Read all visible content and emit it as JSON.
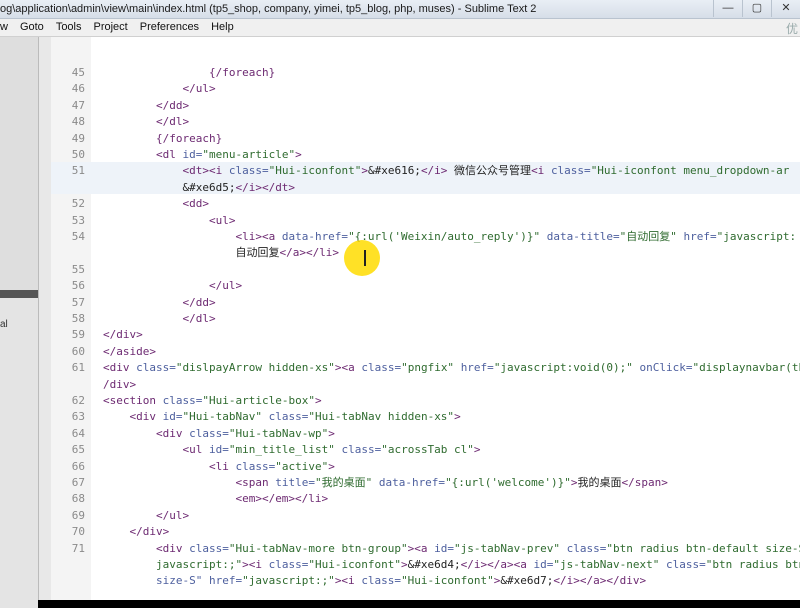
{
  "window": {
    "title": "og\\application\\admin\\view\\main\\index.html (tp5_shop, company, yimei, tp5_blog, php, muses) - Sublime Text 2",
    "buttons": [
      "—",
      "▢",
      "✕"
    ]
  },
  "menu": [
    "w",
    "Goto",
    "Tools",
    "Project",
    "Preferences",
    "Help"
  ],
  "watermark": "优",
  "sidebar_fragment": "al",
  "lines": [
    {
      "n": "45",
      "html": "                <span class=\"tag\">{/foreach}</span>"
    },
    {
      "n": "46",
      "html": "            <span class=\"tag\">&lt;/ul&gt;</span>"
    },
    {
      "n": "47",
      "html": "        <span class=\"tag\">&lt;/dd&gt;</span>"
    },
    {
      "n": "48",
      "html": "        <span class=\"tag\">&lt;/dl&gt;</span>"
    },
    {
      "n": "49",
      "html": "        <span class=\"tag\">{/foreach}</span>"
    },
    {
      "n": "50",
      "html": "        <span class=\"tag\">&lt;dl</span> <span class=\"attr\">id=</span><span class=\"str\">\"menu-article\"</span><span class=\"tag\">&gt;</span>"
    },
    {
      "n": "51",
      "html": "            <span class=\"tag\">&lt;dt&gt;&lt;i</span> <span class=\"attr\">class=</span><span class=\"str\">\"Hui-iconfont\"</span><span class=\"tag\">&gt;</span>&amp;#xe616;<span class=\"tag\">&lt;/i&gt;</span> 微信公众号管理<span class=\"tag\">&lt;i</span> <span class=\"attr\">class=</span><span class=\"str\">\"Hui-iconfont menu_dropdown-ar</span>"
    },
    {
      "n": "",
      "html": "            &amp;#xe6d5;<span class=\"tag\">&lt;/i&gt;&lt;/dt&gt;</span>"
    },
    {
      "n": "52",
      "html": "            <span class=\"tag\">&lt;dd&gt;</span>"
    },
    {
      "n": "53",
      "html": "                <span class=\"tag\">&lt;ul&gt;</span>"
    },
    {
      "n": "54",
      "html": "                    <span class=\"tag\">&lt;li&gt;&lt;a</span> <span class=\"attr\">data-href=</span><span class=\"str\">\"{:url('Weixin/auto_reply')}\"</span> <span class=\"attr\">data-title=</span><span class=\"str\">\"自动回复\"</span> <span class=\"attr\">href=</span><span class=\"str\">\"javascript:</span>"
    },
    {
      "n": "",
      "html": "                    自动回复<span class=\"tag\">&lt;/a&gt;&lt;/li&gt;</span>"
    },
    {
      "n": "55",
      "html": ""
    },
    {
      "n": "56",
      "html": "                <span class=\"tag\">&lt;/ul&gt;</span>"
    },
    {
      "n": "57",
      "html": "            <span class=\"tag\">&lt;/dd&gt;</span>"
    },
    {
      "n": "58",
      "html": "            <span class=\"tag\">&lt;/dl&gt;</span>"
    },
    {
      "n": "59",
      "html": "<span class=\"tag\">&lt;/div&gt;</span>"
    },
    {
      "n": "60",
      "html": "<span class=\"tag\">&lt;/aside&gt;</span>"
    },
    {
      "n": "61",
      "html": "<span class=\"tag\">&lt;div</span> <span class=\"attr\">class=</span><span class=\"str\">\"dislpayArrow hidden-xs\"</span><span class=\"tag\">&gt;&lt;a</span> <span class=\"attr\">class=</span><span class=\"str\">\"pngfix\"</span> <span class=\"attr\">href=</span><span class=\"str\">\"javascript:void(0);\"</span> <span class=\"attr\">onClick=</span><span class=\"str\">\"displaynavbar(th</span>"
    },
    {
      "n": "",
      "html": "<span class=\"tag\">/div&gt;</span>"
    },
    {
      "n": "62",
      "html": "<span class=\"tag\">&lt;section</span> <span class=\"attr\">class=</span><span class=\"str\">\"Hui-article-box\"</span><span class=\"tag\">&gt;</span>"
    },
    {
      "n": "63",
      "html": "    <span class=\"tag\">&lt;div</span> <span class=\"attr\">id=</span><span class=\"str\">\"Hui-tabNav\"</span> <span class=\"attr\">class=</span><span class=\"str\">\"Hui-tabNav hidden-xs\"</span><span class=\"tag\">&gt;</span>"
    },
    {
      "n": "64",
      "html": "        <span class=\"tag\">&lt;div</span> <span class=\"attr\">class=</span><span class=\"str\">\"Hui-tabNav-wp\"</span><span class=\"tag\">&gt;</span>"
    },
    {
      "n": "65",
      "html": "            <span class=\"tag\">&lt;ul</span> <span class=\"attr\">id=</span><span class=\"str\">\"min_title_list\"</span> <span class=\"attr\">class=</span><span class=\"str\">\"acrossTab cl\"</span><span class=\"tag\">&gt;</span>"
    },
    {
      "n": "66",
      "html": "                <span class=\"tag\">&lt;li</span> <span class=\"attr\">class=</span><span class=\"str\">\"active\"</span><span class=\"tag\">&gt;</span>"
    },
    {
      "n": "67",
      "html": "                    <span class=\"tag\">&lt;span</span> <span class=\"attr\">title=</span><span class=\"str\">\"我的桌面\"</span> <span class=\"attr\">data-href=</span><span class=\"str\">\"{:url('welcome')}\"</span><span class=\"tag\">&gt;</span>我的桌面<span class=\"tag\">&lt;/span&gt;</span>"
    },
    {
      "n": "68",
      "html": "                    <span class=\"tag\">&lt;em&gt;&lt;/em&gt;&lt;/li&gt;</span>"
    },
    {
      "n": "69",
      "html": "        <span class=\"tag\">&lt;/ul&gt;</span>"
    },
    {
      "n": "70",
      "html": "    <span class=\"tag\">&lt;/div&gt;</span>"
    },
    {
      "n": "71",
      "html": "        <span class=\"tag\">&lt;div</span> <span class=\"attr\">class=</span><span class=\"str\">\"Hui-tabNav-more btn-group\"</span><span class=\"tag\">&gt;&lt;a</span> <span class=\"attr\">id=</span><span class=\"str\">\"js-tabNav-prev\"</span> <span class=\"attr\">class=</span><span class=\"str\">\"btn radius btn-default size-S</span>"
    },
    {
      "n": "",
      "html": "        <span class=\"str\">javascript:;\"</span><span class=\"tag\">&gt;&lt;i</span> <span class=\"attr\">class=</span><span class=\"str\">\"Hui-iconfont\"</span><span class=\"tag\">&gt;</span>&amp;#xe6d4;<span class=\"tag\">&lt;/i&gt;&lt;/a&gt;&lt;a</span> <span class=\"attr\">id=</span><span class=\"str\">\"js-tabNav-next\"</span> <span class=\"attr\">class=</span><span class=\"str\">\"btn radius btn</span>"
    },
    {
      "n": "",
      "html": "        <span class=\"attr\">size-S\"</span> <span class=\"attr\">href=</span><span class=\"str\">\"javascript:;\"</span><span class=\"tag\">&gt;&lt;i</span> <span class=\"attr\">class=</span><span class=\"str\">\"Hui-iconfont\"</span><span class=\"tag\">&gt;</span>&amp;#xe6d7;<span class=\"tag\">&lt;/i&gt;&lt;/a&gt;&lt;/div&gt;</span>"
    }
  ]
}
